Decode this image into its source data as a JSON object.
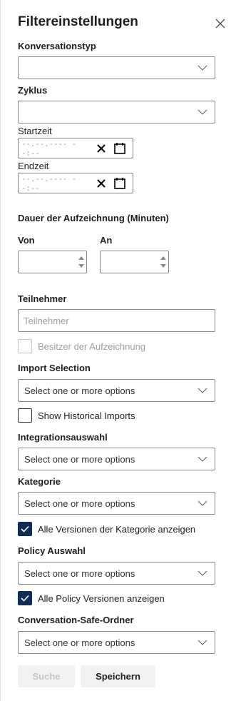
{
  "panel": {
    "title": "Filtereinstellungen",
    "close_icon": "close-icon"
  },
  "conversation_type": {
    "label": "Konversationstyp",
    "value": ""
  },
  "cycle": {
    "label": "Zyklus",
    "value": ""
  },
  "start_time": {
    "label": "Startzeit",
    "placeholder": "--.--.---- --:--"
  },
  "end_time": {
    "label": "Endzeit",
    "placeholder": "--.--.---- --:--"
  },
  "duration": {
    "label": "Dauer der Aufzeichnung (Minuten)",
    "from_label": "Von",
    "to_label": "An",
    "from_value": "",
    "to_value": ""
  },
  "participants": {
    "label": "Teilnehmer",
    "placeholder": "Teilnehmer"
  },
  "owner_checkbox": {
    "label": "Besitzer der Aufzeichnung",
    "checked": false,
    "disabled": true
  },
  "import_selection": {
    "label": "Import Selection",
    "placeholder": "Select one or more options"
  },
  "historical_checkbox": {
    "label": "Show Historical Imports",
    "checked": false
  },
  "integration": {
    "label": "Integrationsauswahl",
    "placeholder": "Select one or more options"
  },
  "category": {
    "label": "Kategorie",
    "placeholder": "Select one or more options"
  },
  "category_versions_checkbox": {
    "label": "Alle Versionen der Kategorie anzeigen",
    "checked": true
  },
  "policy": {
    "label": "Policy Auswahl",
    "placeholder": "Select one or more options"
  },
  "policy_versions_checkbox": {
    "label": "Alle Policy Versionen anzeigen",
    "checked": true
  },
  "safe_folder": {
    "label": "Conversation-Safe-Ordner",
    "placeholder": "Select one or more options"
  },
  "buttons": {
    "search": "Suche",
    "save": "Speichern"
  },
  "colors": {
    "checkbox_checked": "#0f2d59",
    "border": "#8a8886",
    "placeholder_text": "#a19f9d"
  }
}
